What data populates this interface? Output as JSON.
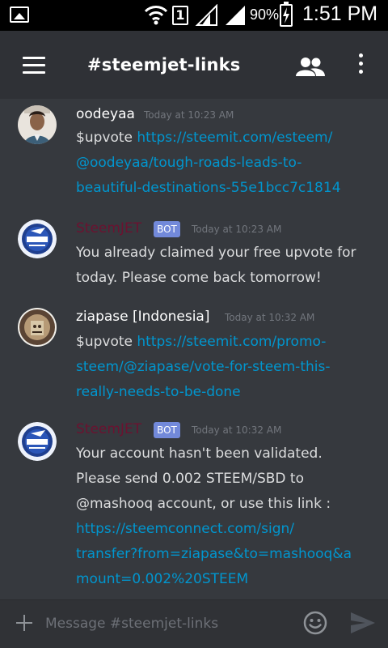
{
  "status_bar": {
    "sim_slot": "1",
    "battery_percent": "90%",
    "time": "1:51 PM",
    "icons": [
      "image-icon",
      "wifi-icon",
      "sim-icon",
      "signal-icon",
      "battery-icon"
    ]
  },
  "header": {
    "channel_name": "#steemjet-links",
    "icons": [
      "menu-icon",
      "members-icon",
      "more-icon"
    ]
  },
  "messages": [
    {
      "author": "oodeyaa",
      "is_bot": false,
      "timestamp": "Today at 10:23 AM",
      "lines": [
        {
          "text": "$upvote ",
          "link": "https://steemit.com/esteem/"
        },
        {
          "text": "",
          "link": "@oodeyaa/tough-roads-leads-to-"
        },
        {
          "text": "",
          "link": "beautiful-destinations-55e1bcc7c1814"
        }
      ]
    },
    {
      "author": "SteemJET",
      "is_bot": true,
      "bot_tag": "BOT",
      "timestamp": "Today at 10:23 AM",
      "lines": [
        {
          "text": "You already claimed your free upvote for",
          "link": ""
        },
        {
          "text": "today. Please come back tomorrow!",
          "link": ""
        }
      ]
    },
    {
      "author": "ziapase [Indonesia]",
      "is_bot": false,
      "timestamp": "Today at 10:32 AM",
      "lines": [
        {
          "text": "$upvote ",
          "link": "https://steemit.com/promo-"
        },
        {
          "text": "",
          "link": "steem/@ziapase/vote-for-steem-this-"
        },
        {
          "text": "",
          "link": "really-needs-to-be-done"
        }
      ]
    },
    {
      "author": "SteemJET",
      "is_bot": true,
      "bot_tag": "BOT",
      "timestamp": "Today at 10:32 AM",
      "lines": [
        {
          "text": "Your account hasn't been validated.",
          "link": ""
        },
        {
          "text": "Please send 0.002 STEEM/SBD to",
          "link": ""
        },
        {
          "text": "@mashooq account, or use this link :",
          "link": ""
        },
        {
          "text": "",
          "link": "https://steemconnect.com/sign/"
        },
        {
          "text": "",
          "link": "transfer?from=ziapase&to=mashooq&a"
        },
        {
          "text": "",
          "link": "mount=0.002%20STEEM"
        }
      ]
    }
  ],
  "composer": {
    "placeholder": "Message #steemjet-links",
    "icons": [
      "plus-icon",
      "emoji-icon",
      "send-icon"
    ]
  },
  "colors": {
    "background": "#36393e",
    "header": "#2f3136",
    "link": "#0096cf",
    "bot_name": "#6b1230",
    "bot_tag": "#7289da",
    "timestamp": "#72767d"
  }
}
